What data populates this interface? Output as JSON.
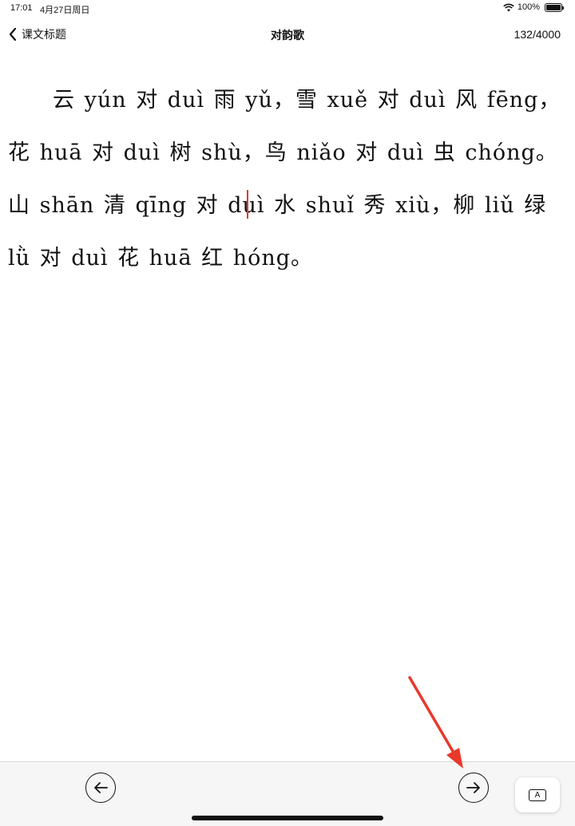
{
  "status_bar": {
    "time": "17:01",
    "date": "4月27日周日",
    "battery": "100%",
    "wifi_icon": "wifi-icon",
    "battery_icon": "battery-icon"
  },
  "nav": {
    "back_label": "课文标题",
    "back_icon": "chevron-left-icon",
    "title": "对韵歌",
    "char_count": "132/4000"
  },
  "lesson": {
    "text": "云 yún 对 duì 雨 yǔ，雪 xuě 对 duì 风 fēng，花 huā 对 duì 树 shù，鸟 niǎo 对 duì 虫 chóng。山 shān 清 qīng 对 duì 水 shuǐ 秀 xiù，柳 liǔ 绿 lǜ 对 duì 花 huā 红 hóng。"
  },
  "toolbar": {
    "prev_icon": "arrow-left-icon",
    "next_icon": "arrow-right-icon",
    "keyboard_label": "A",
    "keyboard_icon": "keyboard-a-icon"
  },
  "colors": {
    "caret": "#e23a2f",
    "annotation": "#e8392b",
    "toolbar_bg": "#f6f6f7"
  }
}
